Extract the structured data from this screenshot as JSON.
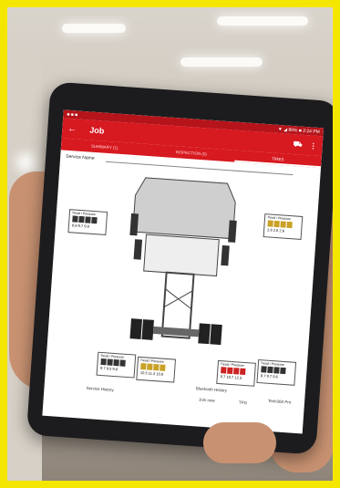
{
  "status_bar": {
    "left": "■ ■ ■",
    "right": "▼ ◢ 86% ■ 2:24 PM"
  },
  "app_bar": {
    "title": "Job",
    "back_icon": "arrow-left-icon",
    "actions": [
      "truck-icon",
      "more-vertical-icon"
    ]
  },
  "tabs": [
    {
      "label": "SUMMARY (1)",
      "active": false
    },
    {
      "label": "INSPECTION (0)",
      "active": false
    },
    {
      "label": "TIRES",
      "active": true
    }
  ],
  "service_name_label": "Service Name",
  "gauges": [
    {
      "title": "Tread / Pressure",
      "values": "9.8  9.7  9.8",
      "color": "#333333"
    },
    {
      "title": "Tread / Pressure",
      "values": "2.6  2.6  2.6",
      "color": "#c9a227"
    },
    {
      "title": "Tread / Pressure",
      "values": "9.7  9.5  9.8",
      "color": "#333333"
    },
    {
      "title": "Tread / Pressure",
      "values": "10.5 11.3 10.6",
      "color": "#c9a227"
    },
    {
      "title": "Tread / Pressure",
      "values": "0.7 10.7 12.3",
      "color": "#cc2222"
    },
    {
      "title": "Tread / Pressure",
      "values": "9.7  9.7  9.6",
      "color": "#333333"
    }
  ],
  "bottom": {
    "service_history": "Service History",
    "bluetooth_history": "Bluetooth History",
    "join_now": "Join now",
    "tpg": "TPG",
    "tech_360": "Tech360 Pro"
  },
  "colors": {
    "brand_red": "#d71920",
    "frame": "#f5e600"
  }
}
